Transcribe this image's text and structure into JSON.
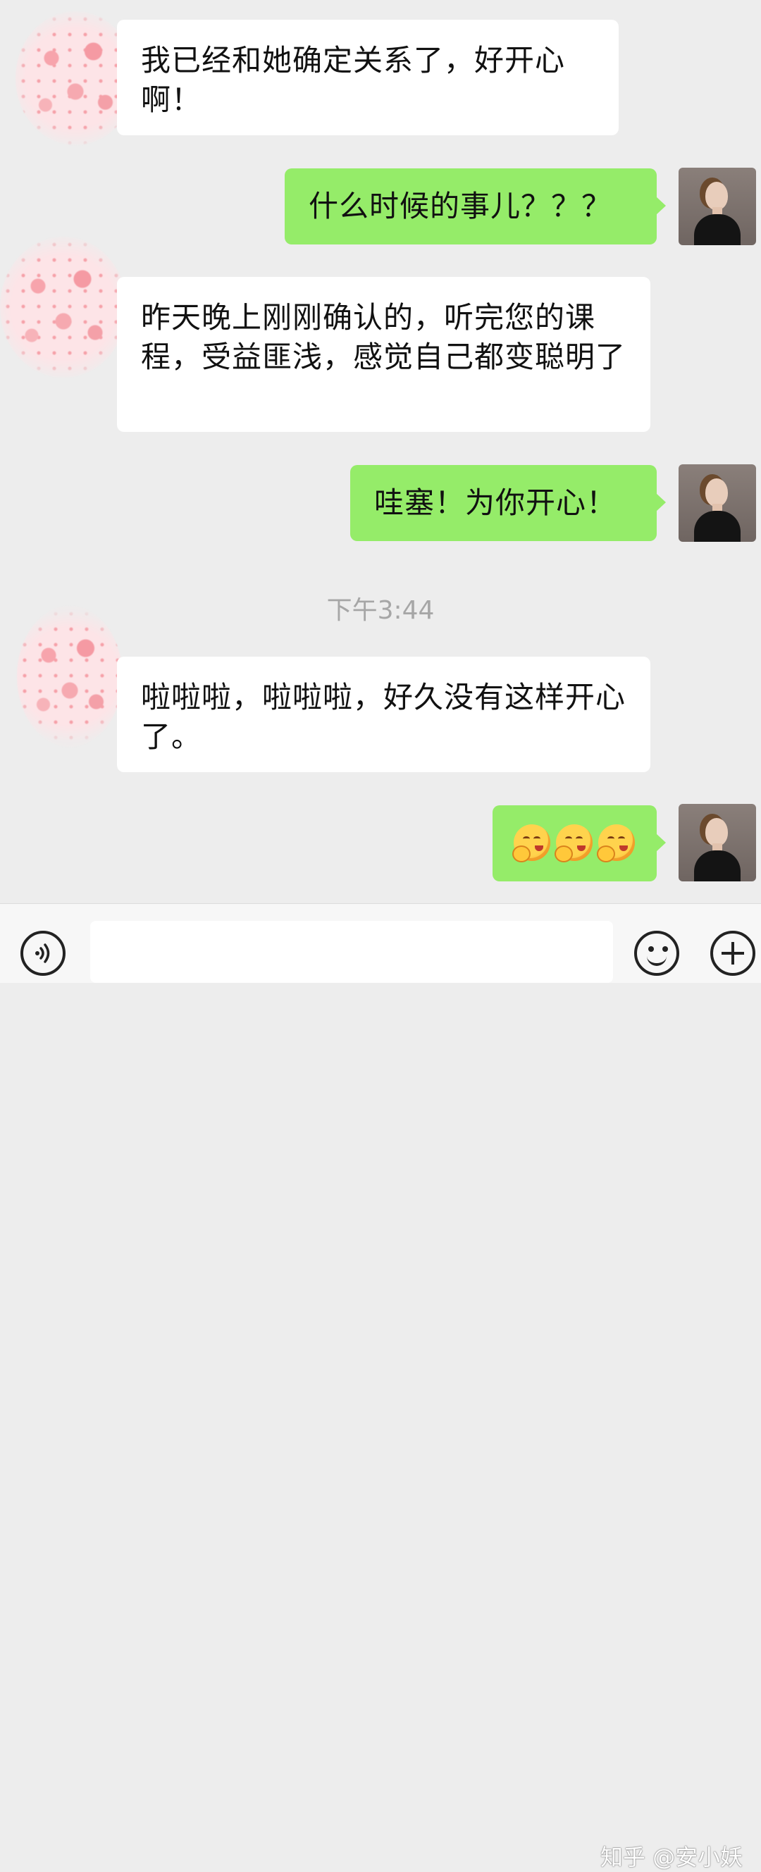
{
  "messages": [
    {
      "side": "in",
      "text": "我已经和她确定关系了，好开心啊！"
    },
    {
      "side": "out",
      "text": "什么时候的事儿？？？"
    },
    {
      "side": "in",
      "text": "昨天晚上刚刚确认的，听完您的课程，受益匪浅，感觉自己都变聪明了"
    },
    {
      "side": "out",
      "text": "哇塞！为你开心！"
    },
    {
      "side": "in",
      "text": "啦啦啦，啦啦啦，好久没有这样开心了。"
    },
    {
      "side": "out",
      "emoji": [
        "hug-face-emoji",
        "hug-face-emoji",
        "hug-face-emoji"
      ]
    }
  ],
  "timestamp": "下午3:44",
  "input_bar": {
    "voice_icon": "voice-icon",
    "text_value": "",
    "emoji_icon": "emoji-face-icon",
    "plus_icon": "plus-icon"
  },
  "watermark": "知乎 @安小妖",
  "colors": {
    "background": "#ededed",
    "incoming_bubble": "#ffffff",
    "outgoing_bubble": "#95ec69",
    "timestamp_text": "#a6a6a6"
  }
}
